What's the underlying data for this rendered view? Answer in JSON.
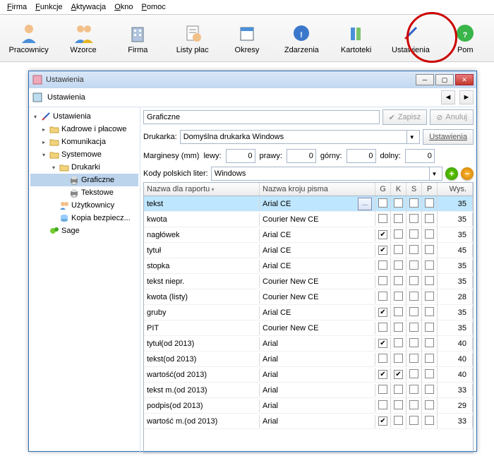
{
  "menubar": [
    "Firma",
    "Funkcje",
    "Aktywacja",
    "Okno",
    "Pomoc"
  ],
  "toolbar": [
    "Pracownicy",
    "Wzorce",
    "Firma",
    "Listy płac",
    "Okresy",
    "Zdarzenia",
    "Kartoteki",
    "Ustawienia",
    "Pom"
  ],
  "highlight_index": 7,
  "window": {
    "title": "Ustawienia",
    "sub_title": "Ustawienia",
    "breadcrumb": "Graficzne",
    "save": "Zapisz",
    "cancel": "Anuluj"
  },
  "tree": [
    {
      "level": 0,
      "arrow": "▾",
      "label": "Ustawienia",
      "icon": "wrench"
    },
    {
      "level": 1,
      "arrow": "▸",
      "label": "Kadrowe i płacowe",
      "icon": "folder"
    },
    {
      "level": 1,
      "arrow": "▸",
      "label": "Komunikacja",
      "icon": "folder"
    },
    {
      "level": 1,
      "arrow": "▾",
      "label": "Systemowe",
      "icon": "folder"
    },
    {
      "level": 2,
      "arrow": "▾",
      "label": "Drukarki",
      "icon": "folder"
    },
    {
      "level": 3,
      "arrow": "",
      "label": "Graficzne",
      "icon": "printer",
      "sel": true
    },
    {
      "level": 3,
      "arrow": "",
      "label": "Tekstowe",
      "icon": "printer"
    },
    {
      "level": 2,
      "arrow": "",
      "label": "Użytkownicy",
      "icon": "users"
    },
    {
      "level": 2,
      "arrow": "",
      "label": "Kopia bezpiecz...",
      "icon": "backup"
    },
    {
      "level": 1,
      "arrow": "",
      "label": "Sage",
      "icon": "sage"
    }
  ],
  "pane": {
    "printer_label": "Drukarka:",
    "printer_value": "Domyślna drukarka Windows",
    "settings_btn": "Ustawienia",
    "margins_label": "Marginesy (mm)",
    "margin_left_l": "lewy:",
    "margin_left_v": "0",
    "margin_right_l": "prawy:",
    "margin_right_v": "0",
    "margin_top_l": "górny:",
    "margin_top_v": "0",
    "margin_bottom_l": "dolny:",
    "margin_bottom_v": "0",
    "encoding_label": "Kody polskich liter:",
    "encoding_value": "Windows"
  },
  "table": {
    "cols": [
      "Nazwa dla raportu",
      "Nazwa kroju pisma",
      "G",
      "K",
      "S",
      "P",
      "Wys."
    ],
    "rows": [
      {
        "name": "tekst",
        "font": "Arial CE",
        "g": false,
        "k": false,
        "s": false,
        "p": false,
        "wys": "35",
        "sel": true,
        "more": true
      },
      {
        "name": "kwota",
        "font": "Courier New CE",
        "g": false,
        "k": false,
        "s": false,
        "p": false,
        "wys": "35"
      },
      {
        "name": "nagłówek",
        "font": "Arial CE",
        "g": true,
        "k": false,
        "s": false,
        "p": false,
        "wys": "35"
      },
      {
        "name": "tytuł",
        "font": "Arial CE",
        "g": true,
        "k": false,
        "s": false,
        "p": false,
        "wys": "45"
      },
      {
        "name": "stopka",
        "font": "Arial CE",
        "g": false,
        "k": false,
        "s": false,
        "p": false,
        "wys": "35"
      },
      {
        "name": "tekst niepr.",
        "font": "Courier New CE",
        "g": false,
        "k": false,
        "s": false,
        "p": false,
        "wys": "35"
      },
      {
        "name": "kwota (listy)",
        "font": "Courier New CE",
        "g": false,
        "k": false,
        "s": false,
        "p": false,
        "wys": "28"
      },
      {
        "name": "gruby",
        "font": "Arial CE",
        "g": true,
        "k": false,
        "s": false,
        "p": false,
        "wys": "35"
      },
      {
        "name": "PIT",
        "font": "Courier New CE",
        "g": false,
        "k": false,
        "s": false,
        "p": false,
        "wys": "35"
      },
      {
        "name": "tytuł(od 2013)",
        "font": "Arial",
        "g": true,
        "k": false,
        "s": false,
        "p": false,
        "wys": "40"
      },
      {
        "name": "tekst(od 2013)",
        "font": "Arial",
        "g": false,
        "k": false,
        "s": false,
        "p": false,
        "wys": "40"
      },
      {
        "name": "wartość(od 2013)",
        "font": "Arial",
        "g": true,
        "k": true,
        "s": false,
        "p": false,
        "wys": "40"
      },
      {
        "name": "tekst m.(od 2013)",
        "font": "Arial",
        "g": false,
        "k": false,
        "s": false,
        "p": false,
        "wys": "33"
      },
      {
        "name": "podpis(od 2013)",
        "font": "Arial",
        "g": false,
        "k": false,
        "s": false,
        "p": false,
        "wys": "29"
      },
      {
        "name": "wartość m.(od 2013)",
        "font": "Arial",
        "g": true,
        "k": false,
        "s": false,
        "p": false,
        "wys": "33"
      }
    ]
  }
}
